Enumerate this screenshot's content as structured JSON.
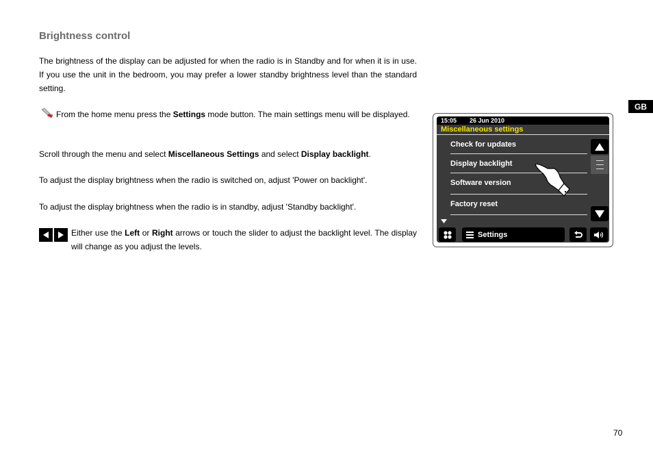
{
  "heading": "Brightness control",
  "intro": "The brightness of the display can be adjusted for when the radio is in Standby and for when it is in use. If you use the unit in the bedroom, you may prefer a lower standby brightness level than the standard setting.",
  "step1": {
    "pre": "From the home menu press the ",
    "bold": "Settings",
    "post": " mode button. The main settings menu will be displayed."
  },
  "step2": {
    "pre": "Scroll through the menu and select ",
    "bold1": "Miscellaneous Settings",
    "mid": " and select ",
    "bold2": "Display backlight",
    "post": "."
  },
  "step3": "To adjust the display brightness when the radio is switched on, adjust 'Power on backlight'.",
  "step4": "To adjust the display brightness when the radio is in standby, adjust 'Standby backlight'.",
  "step5": {
    "pre": "Either use the ",
    "bold1": "Left",
    "mid": " or ",
    "bold2": "Right",
    "post": " arrows or touch the slider to adjust the backlight level. The display will change as you adjust the levels."
  },
  "lang_tab": "GB",
  "page_number": "70",
  "screen": {
    "time": "15:05",
    "date": "26 Jun 2010",
    "title": "Miscellaneous settings",
    "items": [
      "Check for updates",
      "Display backlight",
      "Software version",
      "Factory reset"
    ],
    "bottom_label": "Settings",
    "title_color": "#f2e600"
  }
}
